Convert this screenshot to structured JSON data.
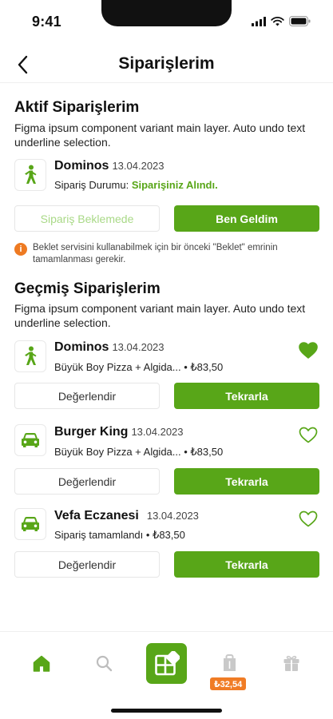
{
  "status_bar": {
    "time": "9:41"
  },
  "header": {
    "title": "Siparişlerim"
  },
  "active": {
    "title": "Aktif Siparişlerim",
    "description": "Figma ipsum component variant main layer. Auto undo text underline selection.",
    "order": {
      "icon": "walking-person-icon",
      "name": "Dominos",
      "date": "13.04.2023",
      "status_label": "Sipariş Durumu:",
      "status_value": "Siparişiniz Alındı."
    },
    "buttons": {
      "waiting": "Sipariş Beklemede",
      "arrived": "Ben Geldim"
    },
    "warning": "Beklet servisini kullanabilmek için bir önceki \"Beklet\" emrinin tamamlanması gerekir."
  },
  "past": {
    "title": "Geçmiş Siparişlerim",
    "description": "Figma ipsum component variant main layer. Auto undo text underline selection.",
    "orders": [
      {
        "icon": "walking-person-icon",
        "name": "Dominos",
        "date": "13.04.2023",
        "details": "Büyük Boy Pizza + Algida... • ₺83,50",
        "favorite": true,
        "rate_label": "Değerlendir",
        "repeat_label": "Tekrarla"
      },
      {
        "icon": "car-icon",
        "name": "Burger King",
        "date": "13.04.2023",
        "details": "Büyük Boy Pizza + Algida... • ₺83,50",
        "favorite": false,
        "rate_label": "Değerlendir",
        "repeat_label": "Tekrarla"
      },
      {
        "icon": "car-icon",
        "name": "Vefa Eczanesi",
        "date": "13.04.2023",
        "details": "Sipariş tamamlandı • ₺83,50",
        "favorite": false,
        "rate_label": "Değerlendir",
        "repeat_label": "Tekrarla"
      }
    ]
  },
  "tabbar": {
    "items": [
      "home-icon",
      "search-icon",
      "grid-plus-icon",
      "wallet-icon",
      "gift-icon"
    ],
    "wallet_badge": "₺32,54"
  },
  "colors": {
    "accent": "#58a618",
    "warning": "#ee7a22",
    "badge": "#f07c25"
  }
}
